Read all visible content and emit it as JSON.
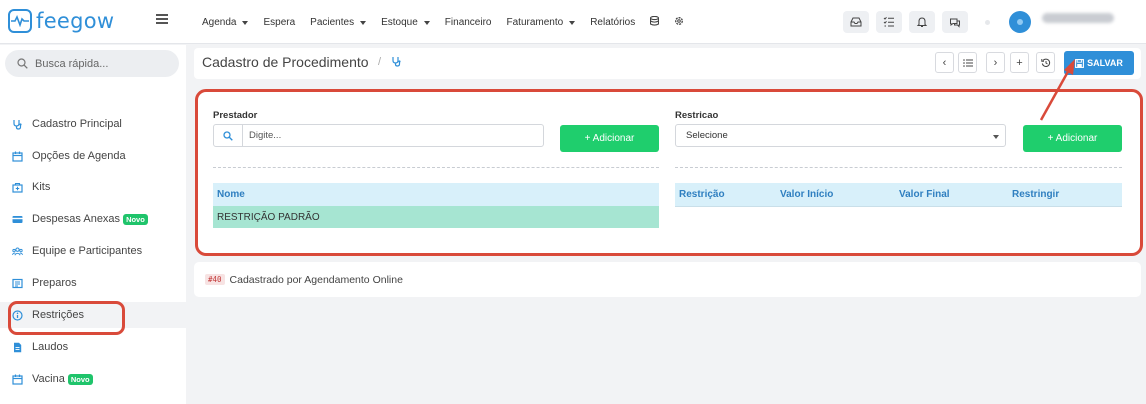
{
  "brand": {
    "name": "feegow",
    "color": "#2f8fd8"
  },
  "nav": {
    "items": [
      {
        "label": "Agenda",
        "dropdown": true
      },
      {
        "label": "Espera",
        "dropdown": false
      },
      {
        "label": "Pacientes",
        "dropdown": true
      },
      {
        "label": "Estoque",
        "dropdown": true
      },
      {
        "label": "Financeiro",
        "dropdown": false
      },
      {
        "label": "Faturamento",
        "dropdown": true
      },
      {
        "label": "Relatórios",
        "dropdown": false
      }
    ],
    "extra_icons": [
      "database-icon",
      "gear-icon"
    ]
  },
  "top_icons": [
    "inbox-icon",
    "checklist-icon",
    "bell-icon",
    "chat-icon"
  ],
  "user": {
    "avatar_color": "#2f8fd8"
  },
  "sidebar": {
    "search_placeholder": "Busca rápida...",
    "items": [
      {
        "label": "Cadastro Principal",
        "icon": "stethoscope-icon",
        "badge": ""
      },
      {
        "label": "Opções de Agenda",
        "icon": "calendar-icon",
        "badge": ""
      },
      {
        "label": "Kits",
        "icon": "kit-icon",
        "badge": ""
      },
      {
        "label": "Despesas Anexas",
        "icon": "card-icon",
        "badge": "Novo"
      },
      {
        "label": "Equipe e Participantes",
        "icon": "team-icon",
        "badge": ""
      },
      {
        "label": "Preparos",
        "icon": "list-icon",
        "badge": ""
      },
      {
        "label": "Restrições",
        "icon": "info-icon",
        "badge": "",
        "active": true
      },
      {
        "label": "Laudos",
        "icon": "file-icon",
        "badge": ""
      },
      {
        "label": "Vacina",
        "icon": "calendar-icon",
        "badge": "Novo"
      }
    ]
  },
  "header": {
    "title": "Cadastro de Procedimento",
    "separator": "/",
    "save_label": "SALVAR",
    "buttons": [
      "chevron-left-icon",
      "list-icon",
      "chevron-right-icon",
      "plus-icon",
      "history-icon"
    ]
  },
  "form": {
    "prestador": {
      "label": "Prestador",
      "placeholder": "Digite...",
      "add_label": "+ Adicionar",
      "table_header": "Nome",
      "rows": [
        "RESTRIÇÃO PADRÃO"
      ]
    },
    "restricao": {
      "label": "Restricao",
      "selected": "Selecione",
      "add_label": "+ Adicionar",
      "columns": [
        "Restrição",
        "Valor Início",
        "Valor Final",
        "Restringir"
      ]
    }
  },
  "footer": {
    "code": "#40",
    "text": "Cadastrado por Agendamento Online"
  },
  "colors": {
    "accent": "#2f8fd8",
    "success": "#1fce6d",
    "highlight": "#d94a3a",
    "table_header": "#d8f0fa",
    "row_selected": "#a6e5d2"
  }
}
